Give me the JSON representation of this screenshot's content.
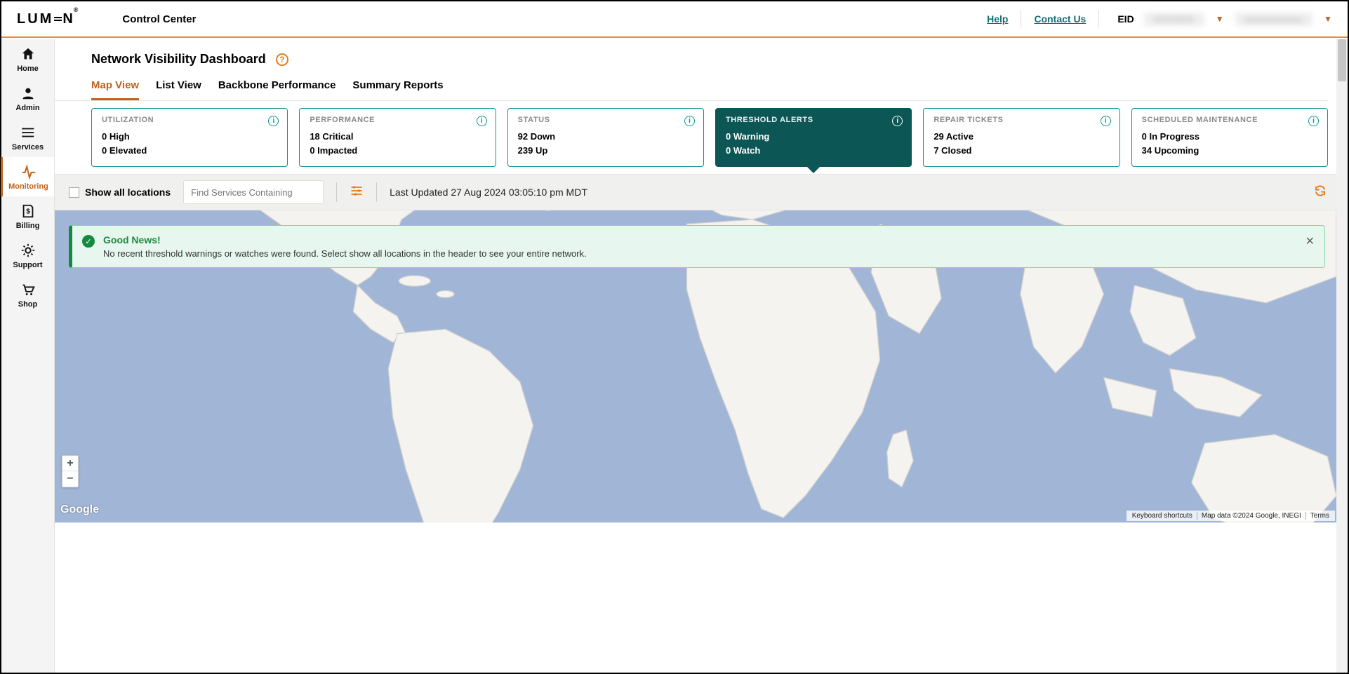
{
  "brand": "LUMEN",
  "app_title": "Control Center",
  "header_links": {
    "help": "Help",
    "contact": "Contact Us"
  },
  "user": {
    "eid_label": "EID",
    "eid_value": "XXXXXX",
    "name": "xxxxxxxxxxx"
  },
  "sidebar": [
    {
      "label": "Home"
    },
    {
      "label": "Admin"
    },
    {
      "label": "Services"
    },
    {
      "label": "Monitoring",
      "active": true
    },
    {
      "label": "Billing"
    },
    {
      "label": "Support"
    },
    {
      "label": "Shop"
    }
  ],
  "page_title": "Network Visibility Dashboard",
  "tabs": [
    {
      "label": "Map View",
      "active": true
    },
    {
      "label": "List View"
    },
    {
      "label": "Backbone Performance"
    },
    {
      "label": "Summary Reports"
    }
  ],
  "cards": [
    {
      "title": "UTILIZATION",
      "line1": "0 High",
      "line2": "0 Elevated"
    },
    {
      "title": "PERFORMANCE",
      "line1": "18 Critical",
      "line2": "0 Impacted"
    },
    {
      "title": "STATUS",
      "line1": "92 Down",
      "line2": "239 Up"
    },
    {
      "title": "THRESHOLD ALERTS",
      "line1": "0 Warning",
      "line2": "0 Watch",
      "active": true
    },
    {
      "title": "REPAIR TICKETS",
      "line1": "29 Active",
      "line2": "7 Closed"
    },
    {
      "title": "SCHEDULED MAINTENANCE",
      "line1": "0 In Progress",
      "line2": "34 Upcoming"
    }
  ],
  "toolbar": {
    "checkbox_label": "Show all locations",
    "search_placeholder": "Find Services Containing",
    "last_updated": "Last Updated 27 Aug 2024 03:05:10 pm MDT"
  },
  "banner": {
    "title": "Good News!",
    "body": "No recent threshold warnings or watches were found. Select show all locations in the header to see your entire network."
  },
  "map": {
    "google": "Google",
    "kb_shortcuts": "Keyboard shortcuts",
    "map_data": "Map data ©2024 Google, INEGI",
    "terms": "Terms"
  }
}
